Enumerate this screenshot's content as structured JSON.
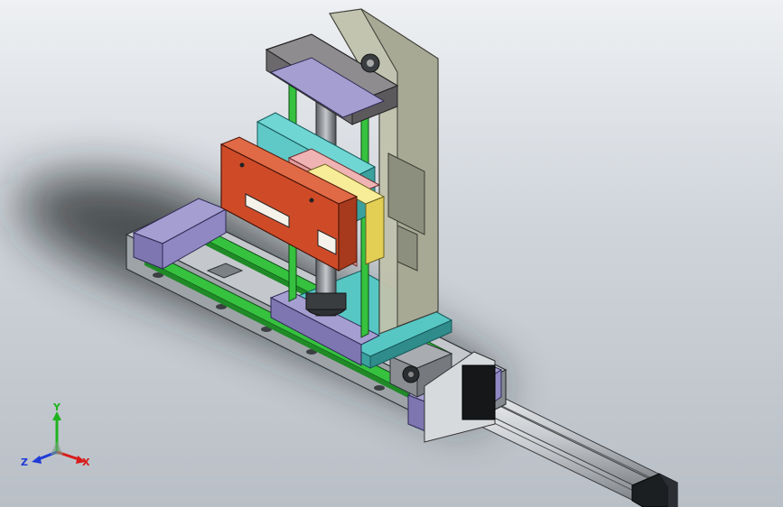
{
  "app": {
    "title": ""
  },
  "triad": {
    "x_label": "X",
    "y_label": "Y",
    "z_label": "Z",
    "x_color": "#d81b1b",
    "y_color": "#1fb31f",
    "z_color": "#1f3bd8"
  },
  "colors": {
    "background_top": "#eef0f3",
    "background_bottom": "#b9bfc6",
    "shadow": "#202225",
    "base_plate": "#b8bcc0",
    "rail": "#36c23f",
    "carriage": "#9c95c8",
    "column": "#b7b8a8",
    "cyan_plate": "#5fc9c7",
    "orange_plate": "#cf4b28",
    "pink_plate": "#e39a9a",
    "yellow_plate": "#f1e27c",
    "cylinder": "#c9ccd0",
    "cap": "#1c1f21"
  },
  "model": {
    "parts": [
      "base-plate",
      "linear-rail",
      "carriage",
      "column",
      "top-plate",
      "ball-screw",
      "cyan-plate",
      "pink-plate",
      "yellow-plate",
      "orange-gripper-plate",
      "bottom-carriage-plate",
      "drive-motor",
      "pneumatic-cylinder",
      "cylinder-end-cap"
    ]
  }
}
